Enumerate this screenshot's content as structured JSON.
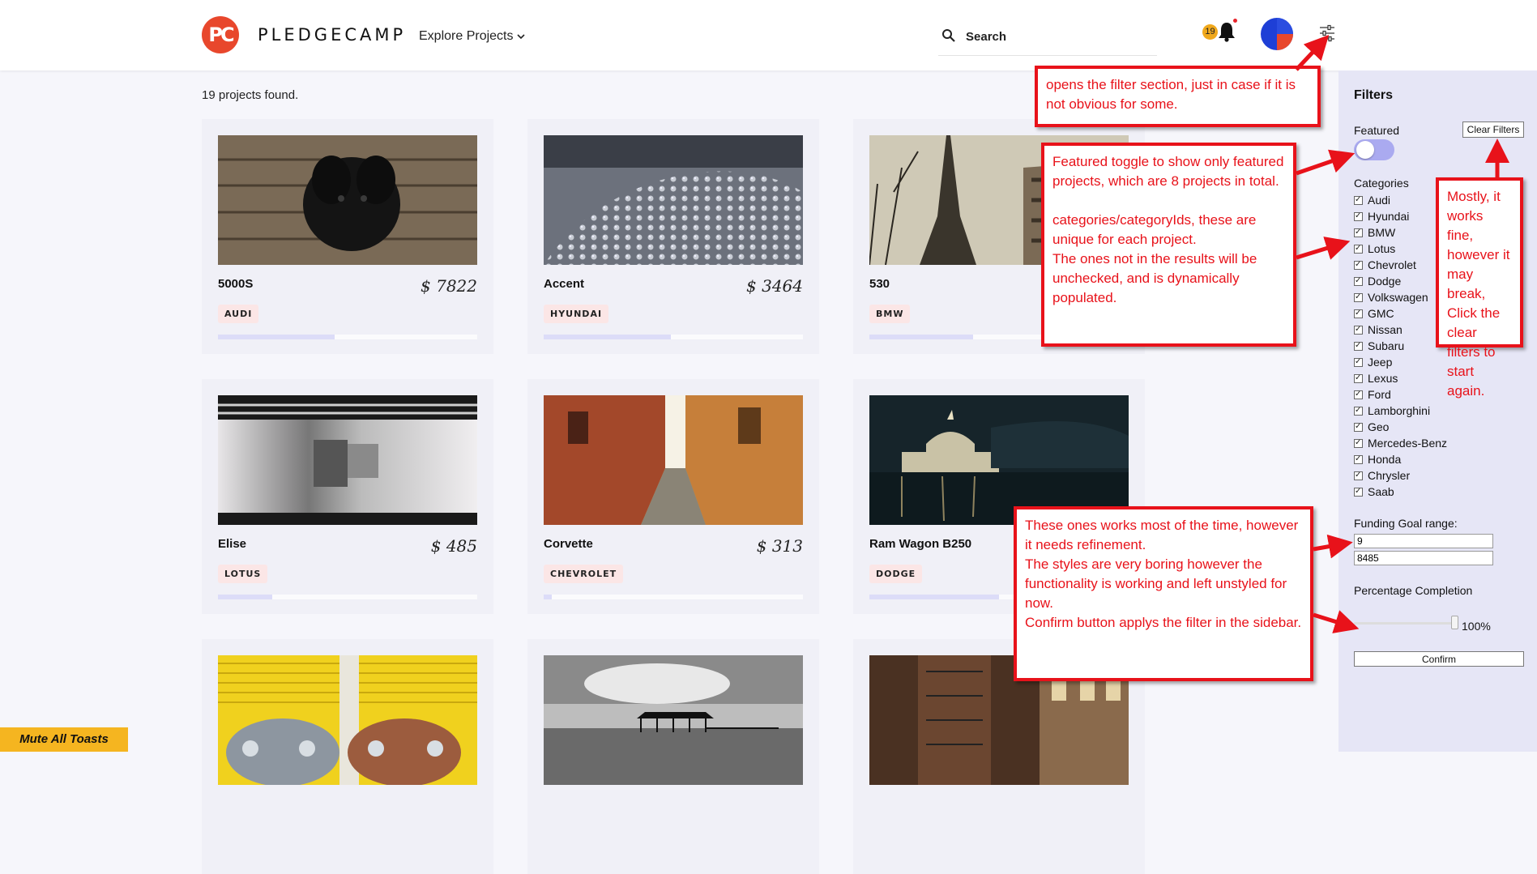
{
  "header": {
    "logo_text": "PC",
    "brand": "PLEDGECAMP",
    "explore": "Explore Projects",
    "search_placeholder": "Search",
    "notification_count": "19"
  },
  "results": {
    "count_text": "19 projects found."
  },
  "projects": [
    {
      "name": "5000S",
      "price": "$ 7822",
      "tag": "AUDI",
      "progress": 0.45,
      "image": "black dog on wooden planks"
    },
    {
      "name": "Accent",
      "price": "$ 3464",
      "tag": "HYUNDAI",
      "progress": 0.49,
      "image": "water droplets texture"
    },
    {
      "name": "530",
      "price": "",
      "tag": "BMW",
      "progress": 0.4,
      "image": "eiffel tower and buildings"
    },
    {
      "name": "Elise",
      "price": "$ 485",
      "tag": "LOTUS",
      "progress": 0.21,
      "image": "motion blur train"
    },
    {
      "name": "Corvette",
      "price": "$ 313",
      "tag": "CHEVROLET",
      "progress": 0.03,
      "image": "narrow cobblestone alley"
    },
    {
      "name": "Ram Wagon B250",
      "price": "",
      "tag": "DODGE",
      "progress": 0.5,
      "image": "night city cathedral by river"
    },
    {
      "name": "",
      "price": "",
      "tag": "",
      "progress": 0,
      "image": "two vintage cars against yellow shutters"
    },
    {
      "name": "",
      "price": "",
      "tag": "",
      "progress": 0,
      "image": "pier over the sea black and white"
    },
    {
      "name": "",
      "price": "",
      "tag": "",
      "progress": 0,
      "image": "brick buildings with fire escapes"
    }
  ],
  "sidebar": {
    "title": "Filters",
    "featured_label": "Featured",
    "clear_label": "Clear Filters",
    "categories_label": "Categories",
    "categories": [
      "Audi",
      "Hyundai",
      "BMW",
      "Lotus",
      "Chevrolet",
      "Dodge",
      "Volkswagen",
      "GMC",
      "Nissan",
      "Subaru",
      "Jeep",
      "Lexus",
      "Ford",
      "Lamborghini",
      "Geo",
      "Mercedes-Benz",
      "Honda",
      "Chrysler",
      "Saab"
    ],
    "funding_label": "Funding Goal range:",
    "funding_min": "9",
    "funding_max": "8485",
    "percentage_label": "Percentage Completion",
    "percentage_value": "100%",
    "confirm_label": "Confirm"
  },
  "annotations": [
    {
      "text": "opens the filter section, just in case if it is not obvious for some."
    },
    {
      "text": "Featured toggle to show only featured projects, which are 8 projects in total.\n\ncategories/categoryIds, these are unique for each project.\nThe ones not in the results will be unchecked, and is dynamically populated."
    },
    {
      "text": "Mostly, it works fine, however it may break, Click the clear filters to\nstart again."
    },
    {
      "text": "These ones works most of the time, however it needs refinement.\nThe styles are very boring however the functionality is working and left unstyled for now.\nConfirm button applys the filter in the sidebar."
    }
  ],
  "toast": {
    "mute_label": "Mute All Toasts"
  },
  "colors": {
    "brand": "#e8472c",
    "annotation": "#e8121a",
    "sidebar": "#e6e6f6",
    "toggle": "#aaaaf0",
    "toast": "#f5b520"
  }
}
